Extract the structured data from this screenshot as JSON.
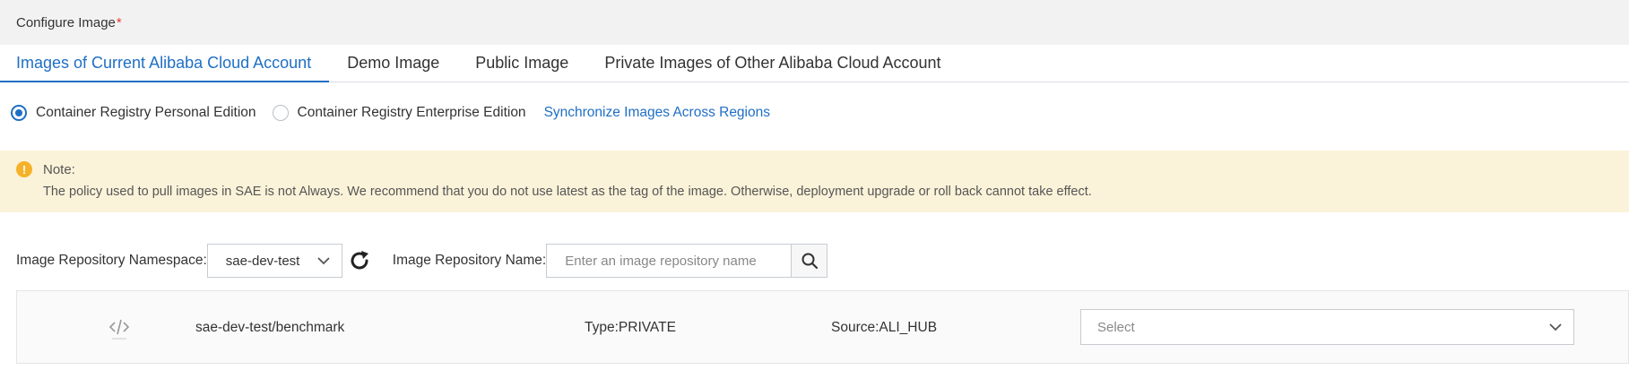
{
  "header": {
    "title": "Configure Image",
    "required_mark": "*"
  },
  "tabs": [
    {
      "label": "Images of Current Alibaba Cloud Account",
      "active": true
    },
    {
      "label": "Demo Image",
      "active": false
    },
    {
      "label": "Public Image",
      "active": false
    },
    {
      "label": "Private Images of Other Alibaba Cloud Account",
      "active": false
    }
  ],
  "registry": {
    "options": [
      {
        "label": "Container Registry Personal Edition",
        "checked": true
      },
      {
        "label": "Container Registry Enterprise Edition",
        "checked": false
      }
    ],
    "sync_link": "Synchronize Images Across Regions"
  },
  "note": {
    "title": "Note:",
    "text": "The policy used to pull images in SAE is not Always. We recommend that you do not use latest as the tag of the image. Otherwise, deployment upgrade or roll back cannot take effect."
  },
  "filters": {
    "namespace_label": "Image Repository Namespace:",
    "namespace_value": "sae-dev-test",
    "name_label": "Image Repository Name:",
    "name_placeholder": "Enter an image repository name",
    "name_value": ""
  },
  "repository": {
    "icon": "code-icon",
    "name": "sae-dev-test/benchmark",
    "type": "Type:PRIVATE",
    "source": "Source:ALI_HUB",
    "tag_placeholder": "Select"
  },
  "colors": {
    "accent": "#1f6fc5",
    "required": "#e23c39",
    "note_bg": "#fbf3d9",
    "warning": "#f5b229",
    "header_bg": "#f2f2f2"
  }
}
